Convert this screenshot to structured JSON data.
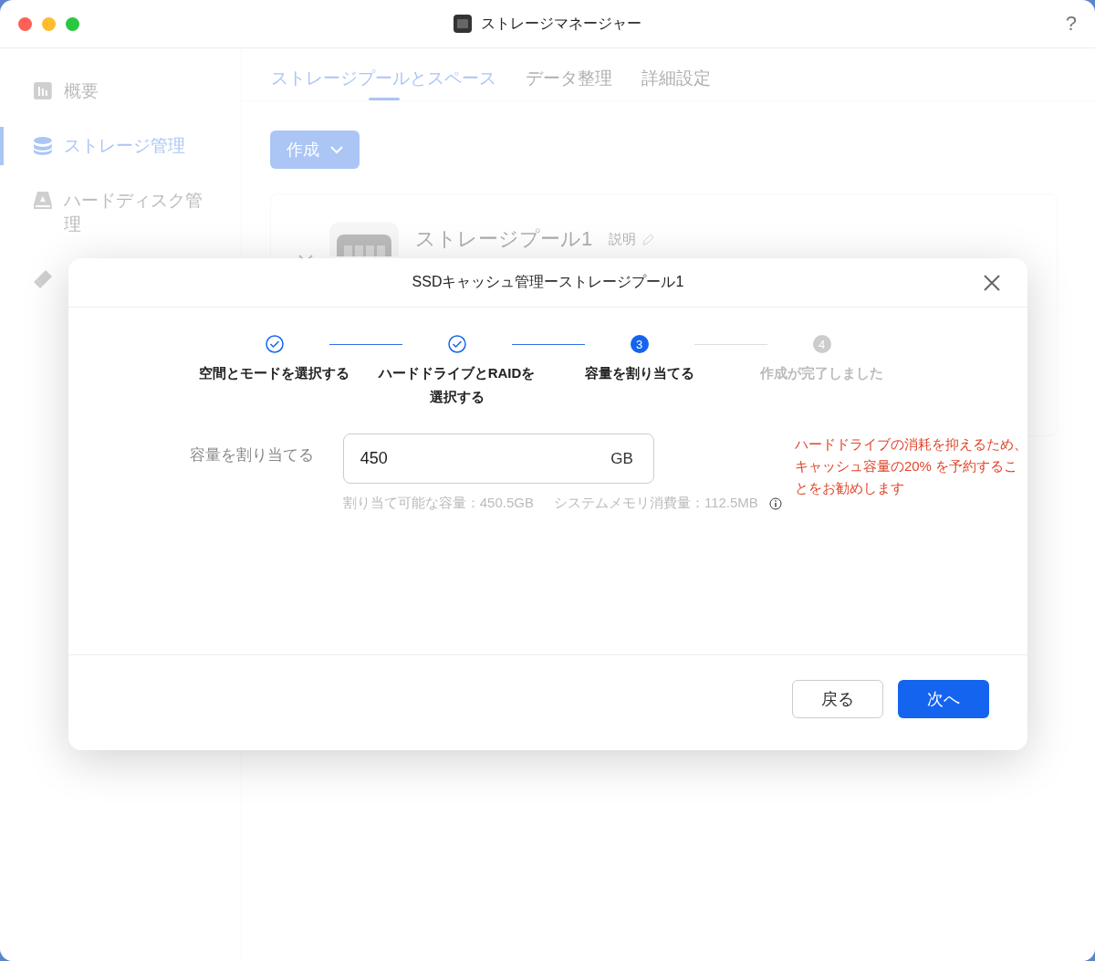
{
  "window": {
    "title": "ストレージマネージャー",
    "help": "?"
  },
  "sidebar": {
    "items": [
      {
        "label": "概要",
        "kind": "chart",
        "selected": false
      },
      {
        "label": "ストレージ管理",
        "kind": "database",
        "selected": true
      },
      {
        "label": "ハードディスク管理",
        "kind": "drive",
        "selected": false
      },
      {
        "kind": "eraser",
        "selected": false
      }
    ]
  },
  "tabs": [
    {
      "label": "ストレージプールとスペース",
      "selected": true
    },
    {
      "label": "データ整理",
      "selected": false
    },
    {
      "label": "詳細設定",
      "selected": false
    }
  ],
  "create_button": {
    "label": "作成"
  },
  "pool_card": {
    "title": "ストレージプール1",
    "description": "説明"
  },
  "dialog": {
    "title": "SSDキャッシュ管理ーストレージプール1",
    "steps": [
      {
        "label": "空間とモードを選択する",
        "kind": "done"
      },
      {
        "label": "ハードドライブとRAIDを選択する",
        "kind": "done"
      },
      {
        "label": "容量を割り当てる",
        "kind": "active",
        "number": "3"
      },
      {
        "label": "作成が完了しました",
        "kind": "pending",
        "number": "4"
      }
    ],
    "field": {
      "label": "容量を割り当てる",
      "value": "450",
      "unit": "GB"
    },
    "warning": "ハードドライブの消耗を抑えるため、キャッシュ容量の20% を予約することをお勧めします",
    "info": [
      "割り当て可能な容量：450.5GB",
      "システムメモリ消費量：112.5MB"
    ],
    "buttons": [
      {
        "label": "戻る",
        "kind": "secondary"
      },
      {
        "label": "次へ",
        "kind": "primary"
      }
    ]
  }
}
